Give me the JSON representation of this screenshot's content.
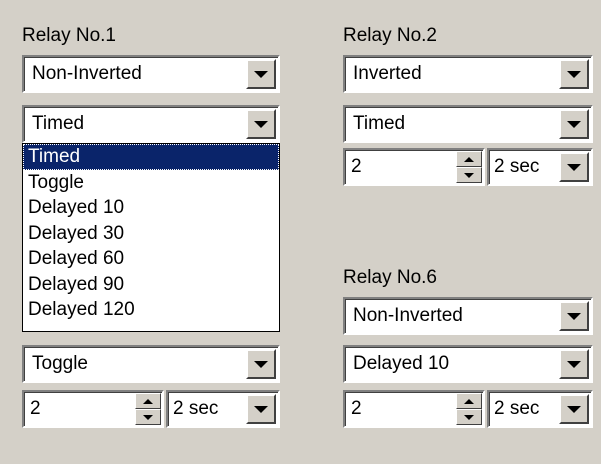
{
  "relay1": {
    "title": "Relay No.1",
    "polarity": "Non-Inverted",
    "mode": "Timed",
    "dropdown_options": [
      "Timed",
      "Toggle",
      "Delayed 10",
      "Delayed 30",
      "Delayed 60",
      "Delayed 90",
      "Delayed 120"
    ],
    "selected_option": "Timed"
  },
  "relay2": {
    "title": "Relay No.2",
    "polarity": "Inverted",
    "mode": "Timed",
    "time_value": "2",
    "time_unit": "2 sec"
  },
  "relay5": {
    "mode": "Toggle",
    "time_value": "2",
    "time_unit": "2 sec"
  },
  "relay6": {
    "title": "Relay No.6",
    "polarity": "Non-Inverted",
    "mode": "Delayed 10",
    "time_value": "2",
    "time_unit": "2 sec"
  },
  "colors": {
    "dialog_bg": "#d4d0c8",
    "selection_bg": "#0a246a",
    "selection_fg": "#ffffff"
  }
}
